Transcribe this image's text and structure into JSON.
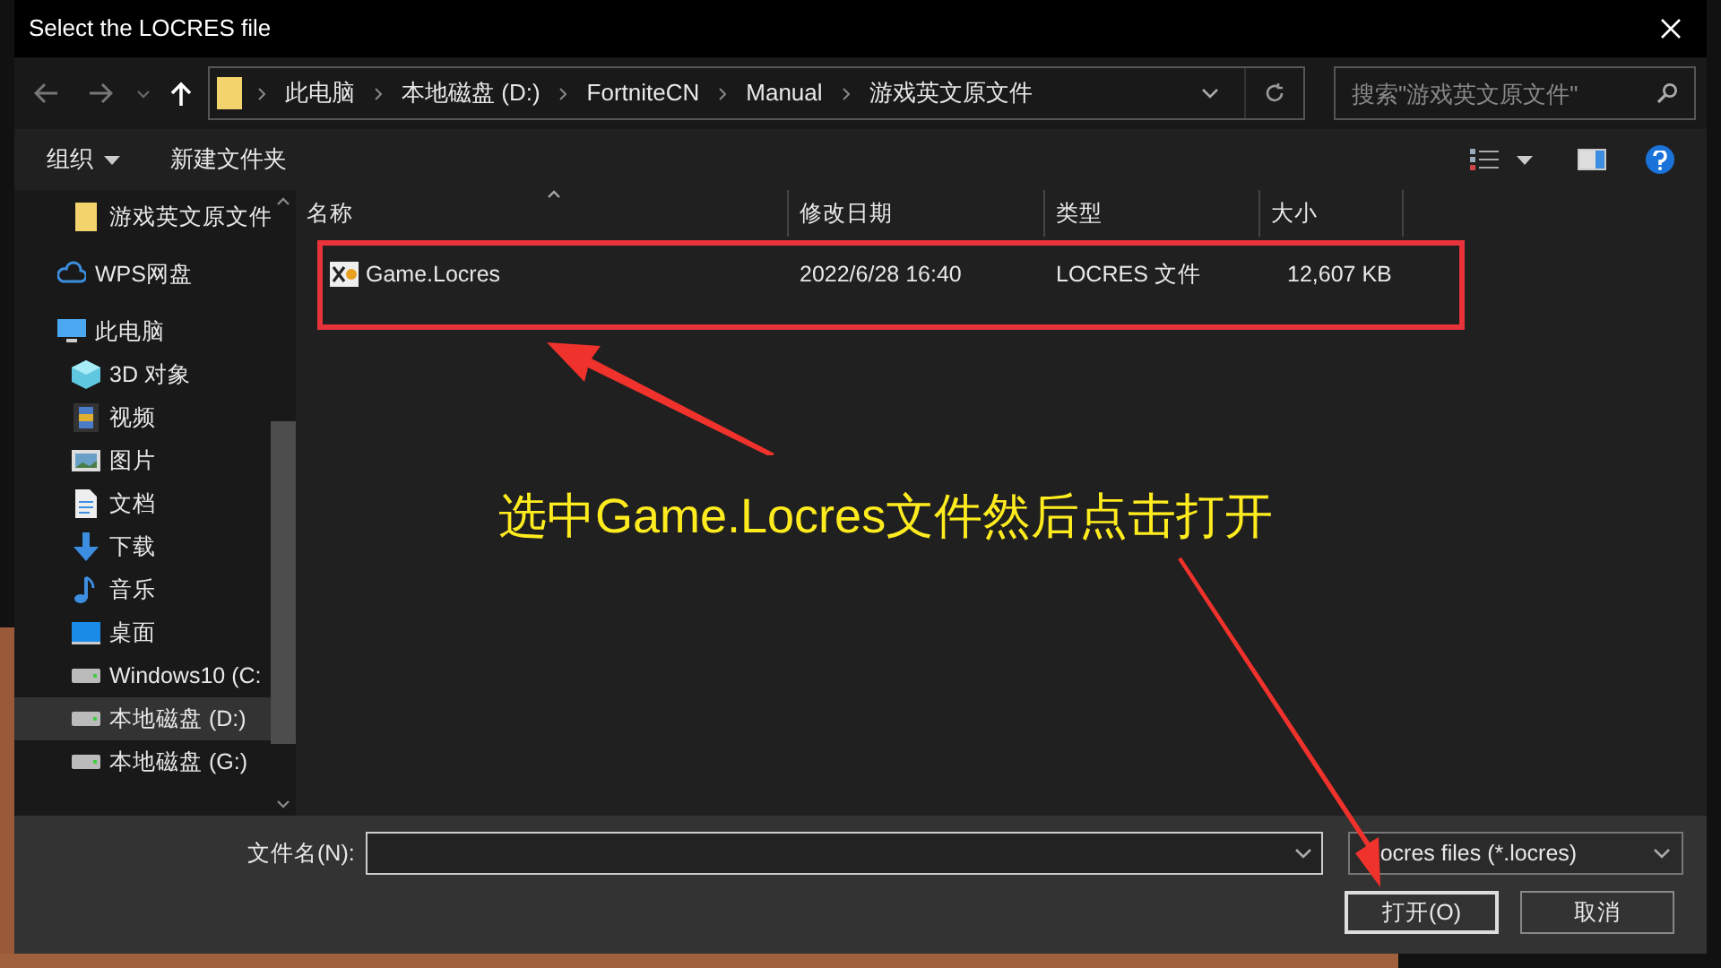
{
  "window": {
    "title": "Select the LOCRES file"
  },
  "address_bar": {
    "path": [
      "此电脑",
      "本地磁盘 (D:)",
      "FortniteCN",
      "Manual",
      "游戏英文原文件"
    ]
  },
  "search": {
    "placeholder": "搜索\"游戏英文原文件\""
  },
  "toolbar": {
    "buttons": [
      "组织",
      "新建文件夹"
    ]
  },
  "sidebar": {
    "sections": [
      {
        "children": [
          {
            "label": "游戏英文原文件",
            "kind": "folder",
            "selected": false
          }
        ]
      },
      {
        "label": "WPS网盘",
        "kind": "cloud",
        "selected": false
      },
      {
        "label": "此电脑",
        "kind": "pc",
        "selected": false,
        "children": [
          {
            "label": "3D 对象",
            "kind": "cube",
            "selected": false
          },
          {
            "label": "视频",
            "kind": "film",
            "selected": false
          },
          {
            "label": "图片",
            "kind": "picture",
            "selected": false
          },
          {
            "label": "文档",
            "kind": "document",
            "selected": false
          },
          {
            "label": "下载",
            "kind": "download",
            "selected": false
          },
          {
            "label": "音乐",
            "kind": "music",
            "selected": false
          },
          {
            "label": "桌面",
            "kind": "desktop",
            "selected": false
          },
          {
            "label": "Windows10 (C:",
            "kind": "drive",
            "selected": false
          },
          {
            "label": "本地磁盘 (D:)",
            "kind": "drive",
            "selected": true
          },
          {
            "label": "本地磁盘 (G:)",
            "kind": "drive",
            "selected": false
          }
        ]
      }
    ]
  },
  "table": {
    "columns": [
      {
        "label": "名称",
        "sorted": true
      },
      {
        "label": "修改日期",
        "sorted": false
      },
      {
        "label": "类型",
        "sorted": false
      },
      {
        "label": "大小",
        "sorted": false
      }
    ],
    "rows": [
      {
        "name": "Game.Locres",
        "date": "2022/6/28 16:40",
        "type": "LOCRES 文件",
        "size": "12,607 KB",
        "highlighted": true
      }
    ]
  },
  "filename": {
    "label": "文件名(N):"
  },
  "filter": {
    "value": "ocres files (*.locres)"
  },
  "buttons": [
    {
      "label": "打开(O)",
      "default": true
    },
    {
      "label": "取消",
      "default": false
    }
  ],
  "annotation": {
    "text": "选中Game.Locres文件然后点击打开"
  }
}
